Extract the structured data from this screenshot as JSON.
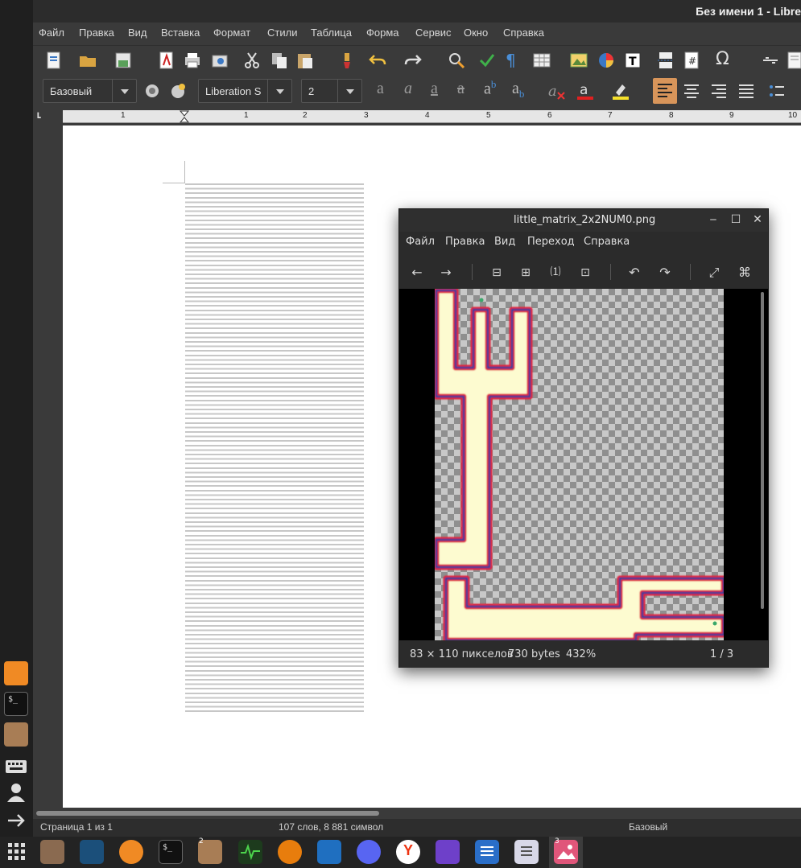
{
  "writer": {
    "title": "Без имени 1 - Libre",
    "menu": [
      "Файл",
      "Правка",
      "Вид",
      "Вставка",
      "Формат",
      "Стили",
      "Таблица",
      "Форма",
      "Сервис",
      "Окно",
      "Справка"
    ],
    "style_combo": "Базовый",
    "font_combo": "Liberation S",
    "size_combo": "2",
    "ruler_numbers": [
      "1",
      "1",
      "2",
      "3",
      "4",
      "5",
      "6",
      "7",
      "8",
      "9",
      "10"
    ],
    "status": {
      "page": "Страница 1 из 1",
      "words": "107 слов, 8 881 символ",
      "style": "Базовый"
    }
  },
  "viewer": {
    "title": "little_matrix_2x2NUM0.png",
    "menu": [
      "Файл",
      "Правка",
      "Вид",
      "Переход",
      "Справка"
    ],
    "status": {
      "dimensions": "83 × 110 пикселов",
      "size": "730 bytes",
      "zoom": "432%",
      "position": "1 / 3"
    }
  },
  "taskbar": {
    "files_badge": "2",
    "viewer_badge": "3"
  },
  "colors": {
    "shape_fill": "#fdfbd0",
    "shape_border_outer": "#e2203a",
    "shape_border_inner": "#3b3f9a",
    "accent_align": "#d8955a"
  }
}
